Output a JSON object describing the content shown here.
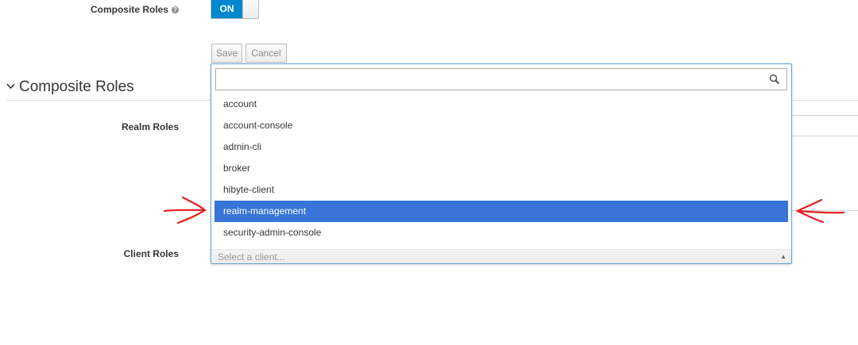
{
  "form": {
    "composite_roles_label": "Composite Roles",
    "help_glyph": "?",
    "toggle_on_label": "ON",
    "save_label": "Save",
    "cancel_label": "Cancel"
  },
  "section": {
    "title": "Composite Roles",
    "realm_roles_label": "Realm Roles",
    "client_roles_label": "Client Roles"
  },
  "dropdown": {
    "search_value": "",
    "options": [
      "account",
      "account-console",
      "admin-cli",
      "broker",
      "hibyte-client",
      "realm-management",
      "security-admin-console"
    ],
    "highlighted": "realm-management",
    "placeholder": "Select a client...",
    "caret": "▲"
  },
  "colors": {
    "accent": "#0088ce",
    "highlight": "#3875d7",
    "annotation_arrows": "#e02020"
  }
}
